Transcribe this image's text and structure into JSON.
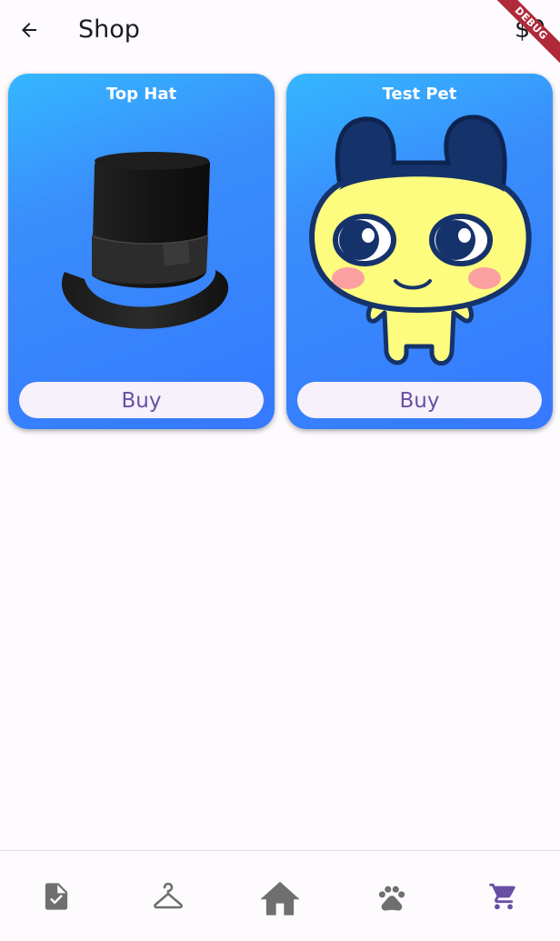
{
  "appbar": {
    "title": "Shop",
    "balance": "$0"
  },
  "debug_banner": "DEBUG",
  "shop_items": [
    {
      "name": "Top Hat",
      "button_label": "Buy"
    },
    {
      "name": "Test Pet",
      "button_label": "Buy"
    }
  ],
  "bottom_nav": {
    "items": [
      {
        "icon": "task-icon",
        "selected": false
      },
      {
        "icon": "hanger-icon",
        "selected": false
      },
      {
        "icon": "home-icon",
        "selected": false
      },
      {
        "icon": "paw-icon",
        "selected": false
      },
      {
        "icon": "cart-icon",
        "selected": true
      }
    ],
    "active_color": "#6750a4",
    "inactive_color": "#6f6f6f"
  }
}
